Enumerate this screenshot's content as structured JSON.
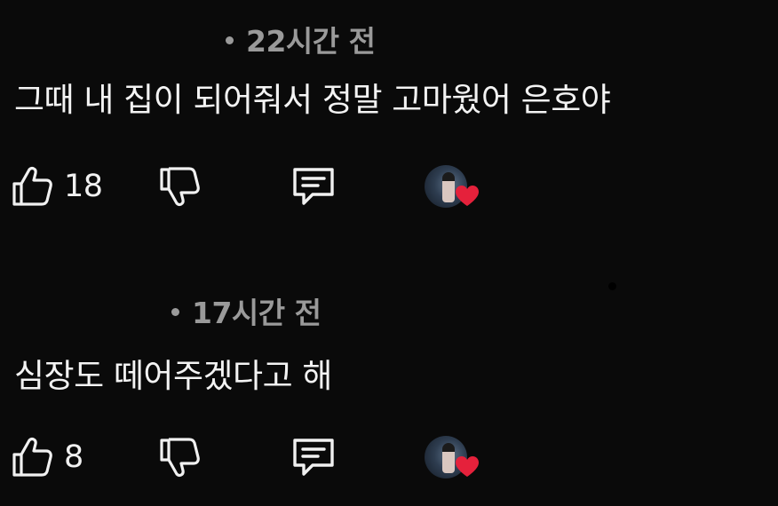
{
  "colors": {
    "background": "#0a0a0a",
    "text": "#f1f1f1",
    "meta_text": "#9a9a9a",
    "heart": "#e5213b"
  },
  "icons": {
    "like": "thumbs-up-outline",
    "dislike": "thumbs-down-outline",
    "reply": "speech-bubble-outline",
    "creator_heart": "heart-filled"
  },
  "comments": [
    {
      "time": "22시간 전",
      "text": "그때 내 집이 되어줘서 정말 고마웠어 은호야",
      "likes": "18",
      "creator_hearted": true
    },
    {
      "time": "17시간 전",
      "text": "심장도 떼어주겠다고 해",
      "likes": "8",
      "creator_hearted": true
    }
  ]
}
